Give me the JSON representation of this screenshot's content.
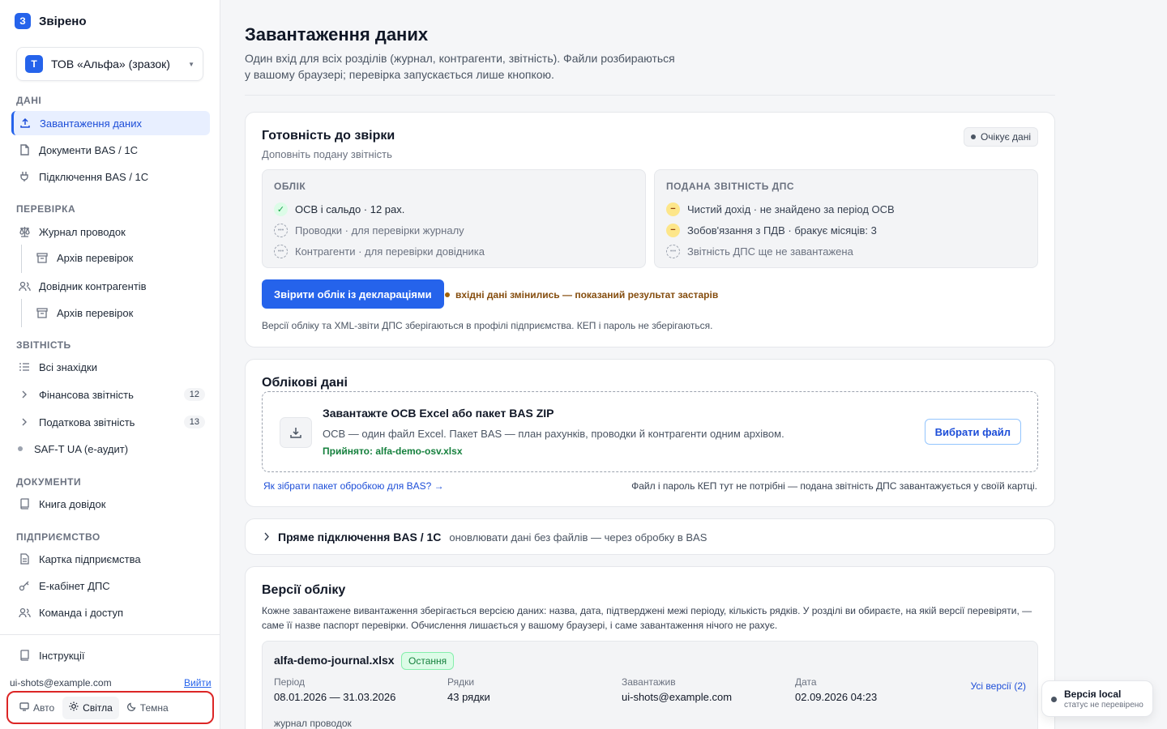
{
  "brand": {
    "badge": "З",
    "name": "Звірено"
  },
  "org": {
    "badge": "Т",
    "name": "ТОВ «Альфа» (зразок)"
  },
  "sidebar": {
    "sections": [
      {
        "title": "ДАНІ"
      },
      {
        "title": "ПЕРЕВІРКА"
      },
      {
        "title": "ЗВІТНІСТЬ"
      },
      {
        "title": "ДОКУМЕНТИ"
      },
      {
        "title": "ПІДПРИЄМСТВО"
      }
    ],
    "items": {
      "upload": "Завантаження даних",
      "bas_docs": "Документи BAS / 1С",
      "bas_connect": "Підключення BAS / 1С",
      "journal": "Журнал проводок",
      "journal_archive": "Архів перевірок",
      "counterparties": "Довідник контрагентів",
      "counterparties_archive": "Архів перевірок",
      "all_findings": "Всі знахідки",
      "financial": "Фінансова звітність",
      "financial_count": "12",
      "tax": "Податкова звітність",
      "tax_count": "13",
      "saft": "SAF-T UA (е-аудит)",
      "cert_book": "Книга довідок",
      "company_card": "Картка підприємства",
      "e_cabinet": "Е-кабінет ДПС",
      "team": "Команда і доступ",
      "instructions": "Інструкції"
    },
    "user_email": "ui-shots@example.com",
    "logout": "Вийти",
    "theme": {
      "auto": "Авто",
      "light": "Світла",
      "dark": "Темна",
      "selected": "Світла"
    }
  },
  "page": {
    "title": "Завантаження даних",
    "subtitle": "Один вхід для всіх розділів (журнал, контрагенти, звітність). Файли розбираються у вашому браузері; перевірка запускається лише кнопкою."
  },
  "readiness": {
    "title": "Готовність до звірки",
    "subtitle": "Доповніть подану звітність",
    "status": "Очікує дані",
    "accounting": {
      "title": "ОБЛІК",
      "rows": [
        {
          "state": "ok",
          "glyph": "✓",
          "text": "ОСВ і сальдо · 12 рах."
        },
        {
          "state": "pending",
          "glyph": "•••",
          "text": "Проводки · для перевірки журналу"
        },
        {
          "state": "pending",
          "glyph": "•••",
          "text": "Контрагенти · для перевірки довідника"
        }
      ]
    },
    "tax": {
      "title": "ПОДАНА ЗВІТНІСТЬ ДПС",
      "rows": [
        {
          "state": "warn",
          "glyph": "−",
          "text": "Чистий дохід · не знайдено за період ОСВ"
        },
        {
          "state": "warn",
          "glyph": "−",
          "text": "Зобов'язання з ПДВ · бракує місяців: 3"
        },
        {
          "state": "pending",
          "glyph": "•••",
          "text": "Звітність ДПС ще не завантажена"
        }
      ]
    },
    "action": "Звірити облік із деклараціями",
    "stale_note": "вхідні дані змінились — показаний результат застарів",
    "footnote": "Версії обліку та XML-звіти ДПС зберігаються в профілі підприємства. КЕП і пароль не зберігаються."
  },
  "accounting_data": {
    "title": "Облікові дані",
    "dropzone": {
      "title": "Завантажте ОСВ Excel або пакет BAS ZIP",
      "desc": "ОСВ — один файл Excel. Пакет BAS — план рахунків, проводки й контрагенти одним архівом.",
      "accepted": "Прийнято: alfa-demo-osv.xlsx",
      "button": "Вибрати файл"
    },
    "help_link": "Як зібрати пакет обробкою для BAS? →",
    "right_note": "Файл і пароль КЕП тут не потрібні — подана звітність ДПС завантажується у своїй картці."
  },
  "direct": {
    "title": "Пряме підключення BAS / 1С",
    "desc": "оновлювати дані без файлів — через обробку в BAS"
  },
  "versions": {
    "title": "Версії обліку",
    "desc": "Кожне завантажене вивантаження зберігається версією даних: назва, дата, підтверджені межі періоду, кількість рядків. У розділі ви обираєте, на якій версії перевіряти, — саме її назве паспорт перевірки. Обчислення лишається у вашому браузері, і саме завантаження нічого не рахує.",
    "latest": {
      "name": "alfa-demo-journal.xlsx",
      "badge": "Остання",
      "period_label": "Період",
      "period": "08.01.2026 — 31.03.2026",
      "rows_label": "Рядки",
      "rows": "43 рядки",
      "uploader_label": "Завантажив",
      "uploader": "ui-shots@example.com",
      "date_label": "Дата",
      "date": "02.09.2026 04:23",
      "all_link": "Усі версії (2)",
      "kind": "журнал проводок"
    }
  },
  "toast": {
    "title": "Версія local",
    "sub": "статус не перевірено"
  }
}
